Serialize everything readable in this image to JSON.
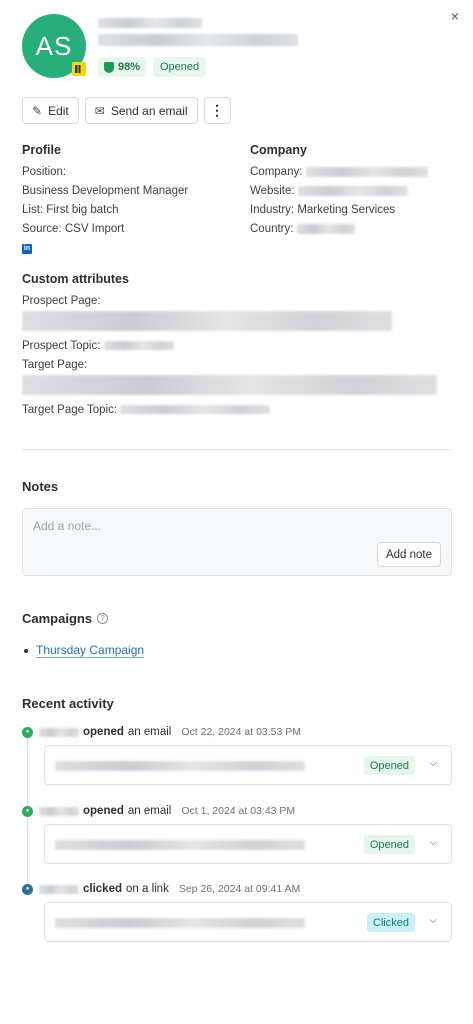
{
  "window": {
    "close_glyph": "×"
  },
  "contact": {
    "initials": "AS",
    "avatar_color": "#27ae7a",
    "score": "98%",
    "status": "Opened"
  },
  "actions": {
    "edit_label": "Edit",
    "send_email_label": "Send an email",
    "more_glyph": "⋮"
  },
  "profile": {
    "title": "Profile",
    "position_label": "Position:",
    "position_value": "Business Development Manager",
    "list_label": "List:",
    "list_value": "First big batch",
    "source_label": "Source:",
    "source_value": "CSV Import",
    "linkedin_glyph": "in"
  },
  "company": {
    "title": "Company",
    "company_label": "Company:",
    "website_label": "Website:",
    "industry_label": "Industry:",
    "industry_value": "Marketing Services",
    "country_label": "Country:"
  },
  "custom_attributes": {
    "title": "Custom attributes",
    "prospect_page_label": "Prospect Page:",
    "prospect_topic_label": "Prospect Topic:",
    "target_page_label": "Target Page:",
    "target_page_topic_label": "Target Page Topic:"
  },
  "notes": {
    "title": "Notes",
    "placeholder": "Add a note...",
    "add_button": "Add note"
  },
  "campaigns": {
    "title": "Campaigns",
    "help_glyph": "?",
    "items": [
      "Thursday Campaign"
    ]
  },
  "recent_activity": {
    "title": "Recent activity",
    "items": [
      {
        "verb": "opened",
        "rest": "an email",
        "time": "Oct 22, 2024 at 03:53 PM",
        "badge": "Opened",
        "icon": "email-opened-icon"
      },
      {
        "verb": "opened",
        "rest": "an email",
        "time": "Oct 1, 2024 at 03:43 PM",
        "badge": "Opened",
        "icon": "email-opened-icon"
      },
      {
        "verb": "clicked",
        "rest": "on a link",
        "time": "Sep 26, 2024 at 09:41 AM",
        "badge": "Clicked",
        "icon": "link-clicked-icon"
      }
    ]
  },
  "colors": {
    "accent_green": "#1f7a45",
    "link_blue": "#2a6fb0",
    "clicked_badge_bg": "#c8f0f5"
  }
}
